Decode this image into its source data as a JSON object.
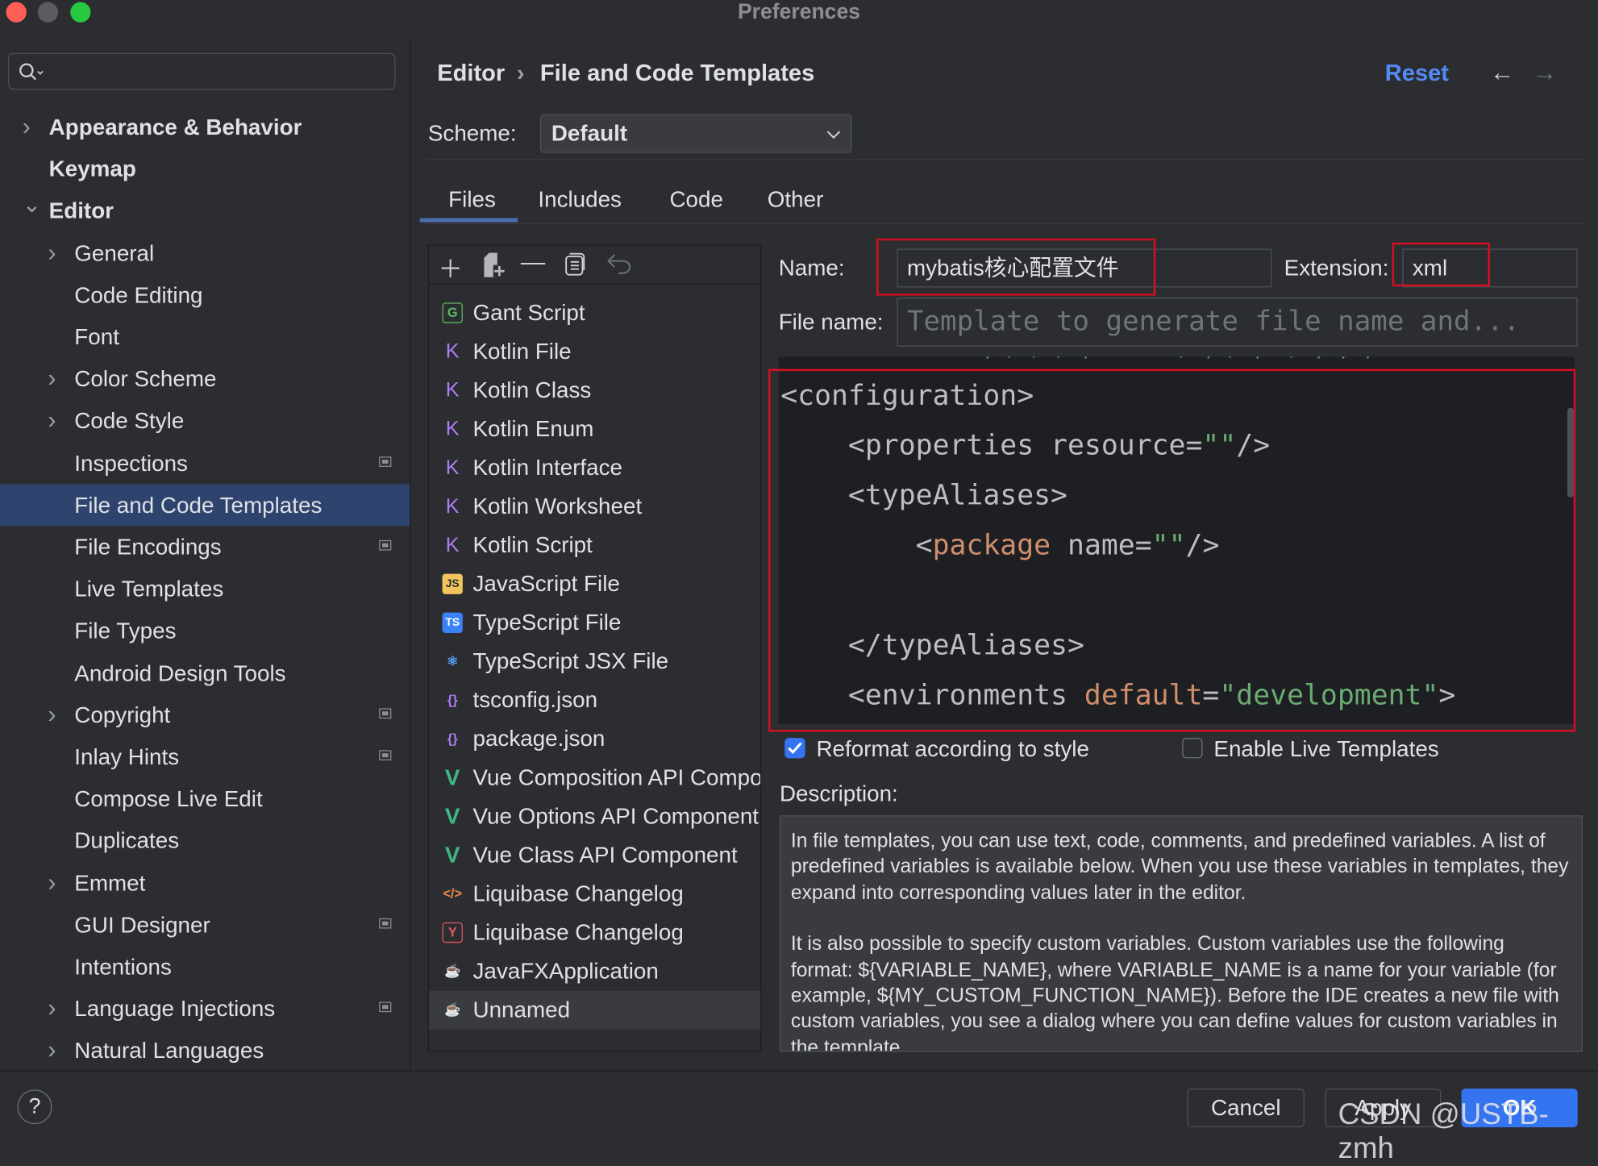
{
  "window": {
    "title": "Preferences"
  },
  "search": {
    "placeholder": ""
  },
  "sidebar": {
    "items": [
      {
        "label": "Appearance & Behavior",
        "level": 0,
        "expandable": true,
        "expanded": false
      },
      {
        "label": "Keymap",
        "level": 0,
        "expandable": false
      },
      {
        "label": "Editor",
        "level": 0,
        "expandable": true,
        "expanded": true
      },
      {
        "label": "General",
        "level": 1,
        "expandable": true
      },
      {
        "label": "Code Editing",
        "level": 1
      },
      {
        "label": "Font",
        "level": 1
      },
      {
        "label": "Color Scheme",
        "level": 1,
        "expandable": true
      },
      {
        "label": "Code Style",
        "level": 1,
        "expandable": true
      },
      {
        "label": "Inspections",
        "level": 1,
        "badge": true
      },
      {
        "label": "File and Code Templates",
        "level": 1,
        "selected": true
      },
      {
        "label": "File Encodings",
        "level": 1,
        "badge": true
      },
      {
        "label": "Live Templates",
        "level": 1
      },
      {
        "label": "File Types",
        "level": 1
      },
      {
        "label": "Android Design Tools",
        "level": 1
      },
      {
        "label": "Copyright",
        "level": 1,
        "expandable": true,
        "badge": true
      },
      {
        "label": "Inlay Hints",
        "level": 1,
        "badge": true
      },
      {
        "label": "Compose Live Edit",
        "level": 1
      },
      {
        "label": "Duplicates",
        "level": 1
      },
      {
        "label": "Emmet",
        "level": 1,
        "expandable": true
      },
      {
        "label": "GUI Designer",
        "level": 1,
        "badge": true
      },
      {
        "label": "Intentions",
        "level": 1
      },
      {
        "label": "Language Injections",
        "level": 1,
        "expandable": true,
        "badge": true
      },
      {
        "label": "Natural Languages",
        "level": 1,
        "expandable": true
      }
    ]
  },
  "header": {
    "breadcrumb": [
      "Editor",
      "File and Code Templates"
    ],
    "separator": "›",
    "reset": "Reset"
  },
  "scheme": {
    "label": "Scheme:",
    "value": "Default"
  },
  "tabs": [
    {
      "label": "Files",
      "active": true
    },
    {
      "label": "Includes"
    },
    {
      "label": "Code"
    },
    {
      "label": "Other"
    }
  ],
  "templates": [
    {
      "label": "Gant Script",
      "icon": "G",
      "color": "#5fb865"
    },
    {
      "label": "Kotlin File",
      "icon": "K",
      "color": "#b07cf5"
    },
    {
      "label": "Kotlin Class",
      "icon": "K",
      "color": "#b07cf5"
    },
    {
      "label": "Kotlin Enum",
      "icon": "K",
      "color": "#b07cf5"
    },
    {
      "label": "Kotlin Interface",
      "icon": "K",
      "color": "#b07cf5"
    },
    {
      "label": "Kotlin Worksheet",
      "icon": "K",
      "color": "#b07cf5"
    },
    {
      "label": "Kotlin Script",
      "icon": "K",
      "color": "#b07cf5"
    },
    {
      "label": "JavaScript File",
      "icon": "JS",
      "color": "#f2c55c"
    },
    {
      "label": "TypeScript File",
      "icon": "TS",
      "color": "#3b82f6"
    },
    {
      "label": "TypeScript JSX File",
      "icon": "⚛",
      "color": "#5c9ef5"
    },
    {
      "label": "tsconfig.json",
      "icon": "{}",
      "color": "#b07cf5"
    },
    {
      "label": "package.json",
      "icon": "{}",
      "color": "#b07cf5"
    },
    {
      "label": "Vue Composition API Component",
      "icon": "V",
      "color": "#41b883"
    },
    {
      "label": "Vue Options API Component",
      "icon": "V",
      "color": "#41b883"
    },
    {
      "label": "Vue Class API Component",
      "icon": "V",
      "color": "#41b883"
    },
    {
      "label": "Liquibase Changelog",
      "icon": "</>",
      "color": "#e8894a"
    },
    {
      "label": "Liquibase Changelog",
      "icon": "Y",
      "color": "#e55765"
    },
    {
      "label": "JavaFXApplication",
      "icon": "☕",
      "color": "#e8894a"
    },
    {
      "label": "Unnamed",
      "icon": "☕",
      "color": "#e8894a",
      "selected": true
    }
  ],
  "form": {
    "name_label": "Name:",
    "name_value": "mybatis核心配置文件",
    "extension_label": "Extension:",
    "extension_value": "xml",
    "filename_label": "File name:",
    "filename_placeholder": "Template to generate file name and..."
  },
  "code": {
    "lines": [
      [
        {
          "t": "<configuration>"
        }
      ],
      [
        {
          "t": "    <properties resource="
        },
        {
          "t": "\"\"",
          "c": "str"
        },
        {
          "t": "/>"
        }
      ],
      [
        {
          "t": "    <typeAliases>"
        }
      ],
      [
        {
          "t": "        <"
        },
        {
          "t": "package",
          "c": "kw"
        },
        {
          "t": " name="
        },
        {
          "t": "\"\"",
          "c": "str"
        },
        {
          "t": "/>"
        }
      ],
      [
        {
          "t": ""
        }
      ],
      [
        {
          "t": "    </typeAliases>"
        }
      ],
      [
        {
          "t": "    <environments "
        },
        {
          "t": "default",
          "c": "kw"
        },
        {
          "t": "="
        },
        {
          "t": "\"development\"",
          "c": "str"
        },
        {
          "t": ">"
        }
      ]
    ]
  },
  "options": {
    "reformat": {
      "label": "Reformat according to style",
      "checked": true
    },
    "live_templates": {
      "label": "Enable Live Templates",
      "checked": false
    }
  },
  "description": {
    "label": "Description:",
    "paragraphs": [
      "In file templates, you can use text, code, comments, and predefined variables. A list of predefined variables is available below. When you use these variables in templates, they expand into corresponding values later in the editor.",
      "It is also possible to specify custom variables. Custom variables use the following format: ${VARIABLE_NAME}, where VARIABLE_NAME is a name for your variable (for example, ${MY_CUSTOM_FUNCTION_NAME}). Before the IDE creates a new file with custom variables, you see a dialog where you can define values for custom variables in the template."
    ]
  },
  "footer": {
    "help": "?",
    "cancel": "Cancel",
    "apply": "Apply",
    "ok": "OK"
  },
  "watermark": "CSDN @USTB-zmh",
  "colors": {
    "accent": "#3574f0",
    "link": "#548af7",
    "highlight": "#d20f25",
    "selection": "#2e436e"
  }
}
